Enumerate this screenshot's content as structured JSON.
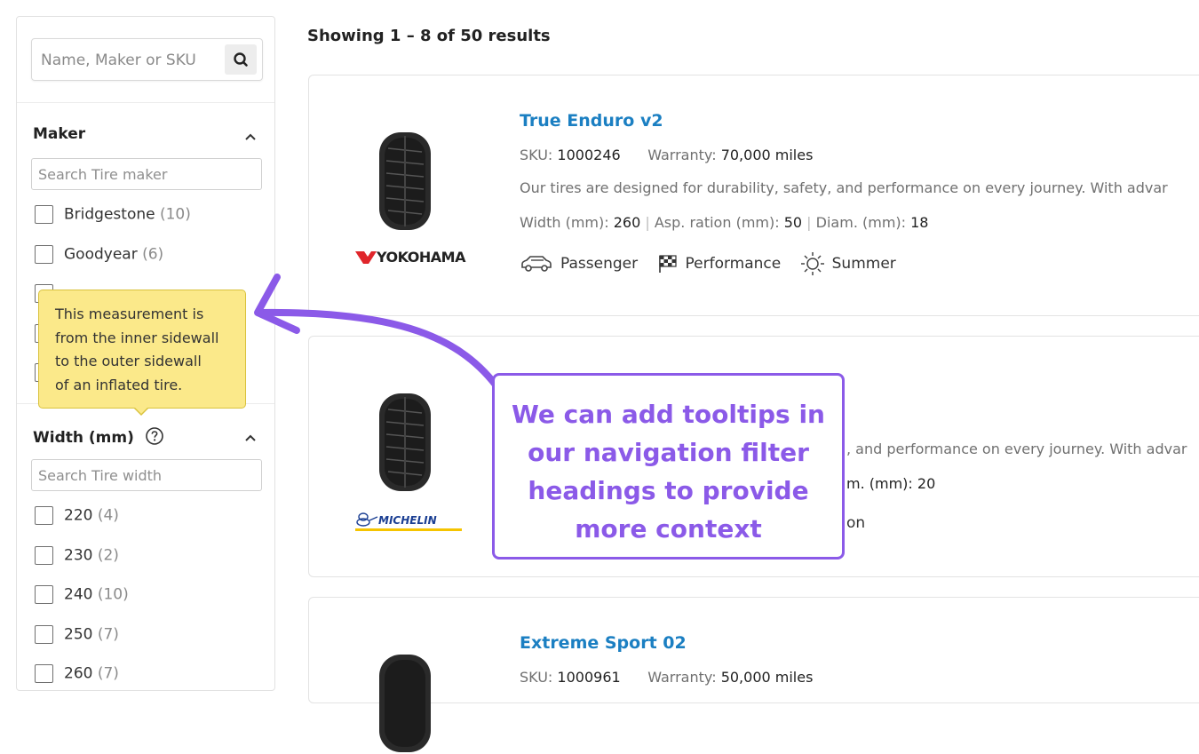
{
  "sidebar": {
    "search_placeholder": "Name, Maker or SKU",
    "maker": {
      "title": "Maker",
      "search_placeholder": "Search Tire maker",
      "options": [
        {
          "label": "Bridgestone",
          "count": "(10)"
        },
        {
          "label": "Goodyear",
          "count": "(6)"
        }
      ]
    },
    "width": {
      "title": "Width (mm)",
      "search_placeholder": "Search Tire width",
      "options": [
        {
          "label": "220",
          "count": "(4)"
        },
        {
          "label": "230",
          "count": "(2)"
        },
        {
          "label": "240",
          "count": "(10)"
        },
        {
          "label": "250",
          "count": "(7)"
        },
        {
          "label": "260",
          "count": "(7)"
        }
      ]
    }
  },
  "tooltip": {
    "lines": [
      "This measurement is",
      "from the inner sidewall",
      "to the outer sidewall",
      "of an inflated tire."
    ]
  },
  "results": {
    "heading": "Showing 1 – 8 of 50 results",
    "products": [
      {
        "title": "True Enduro v2",
        "sku_label": "SKU:",
        "sku": "1000246",
        "warranty_label": "Warranty:",
        "warranty": "70,000 miles",
        "description": "Our tires are designed for durability, safety, and performance on every journey. With advar",
        "width_label": "Width (mm):",
        "width": "260",
        "ratio_label": "Asp. ration (mm):",
        "ratio": "50",
        "diam_label": "Diam. (mm):",
        "diam": "18",
        "brand": "YOKOHAMA",
        "tags": [
          "Passenger",
          "Performance",
          "Summer"
        ]
      },
      {
        "description_fragment": ", and performance on every journey. With advar",
        "diam_fragment": "m. (mm): 20",
        "tag_fragment": "on",
        "brand": "MICHELIN"
      },
      {
        "title": "Extreme Sport 02",
        "sku_label": "SKU:",
        "sku": "1000961",
        "warranty_label": "Warranty:",
        "warranty": "50,000 miles"
      }
    ]
  },
  "callout": {
    "lines": [
      "We can add tooltips in",
      "our navigation filter",
      "headings to provide",
      "more context"
    ],
    "color": "#8b5ae8"
  }
}
